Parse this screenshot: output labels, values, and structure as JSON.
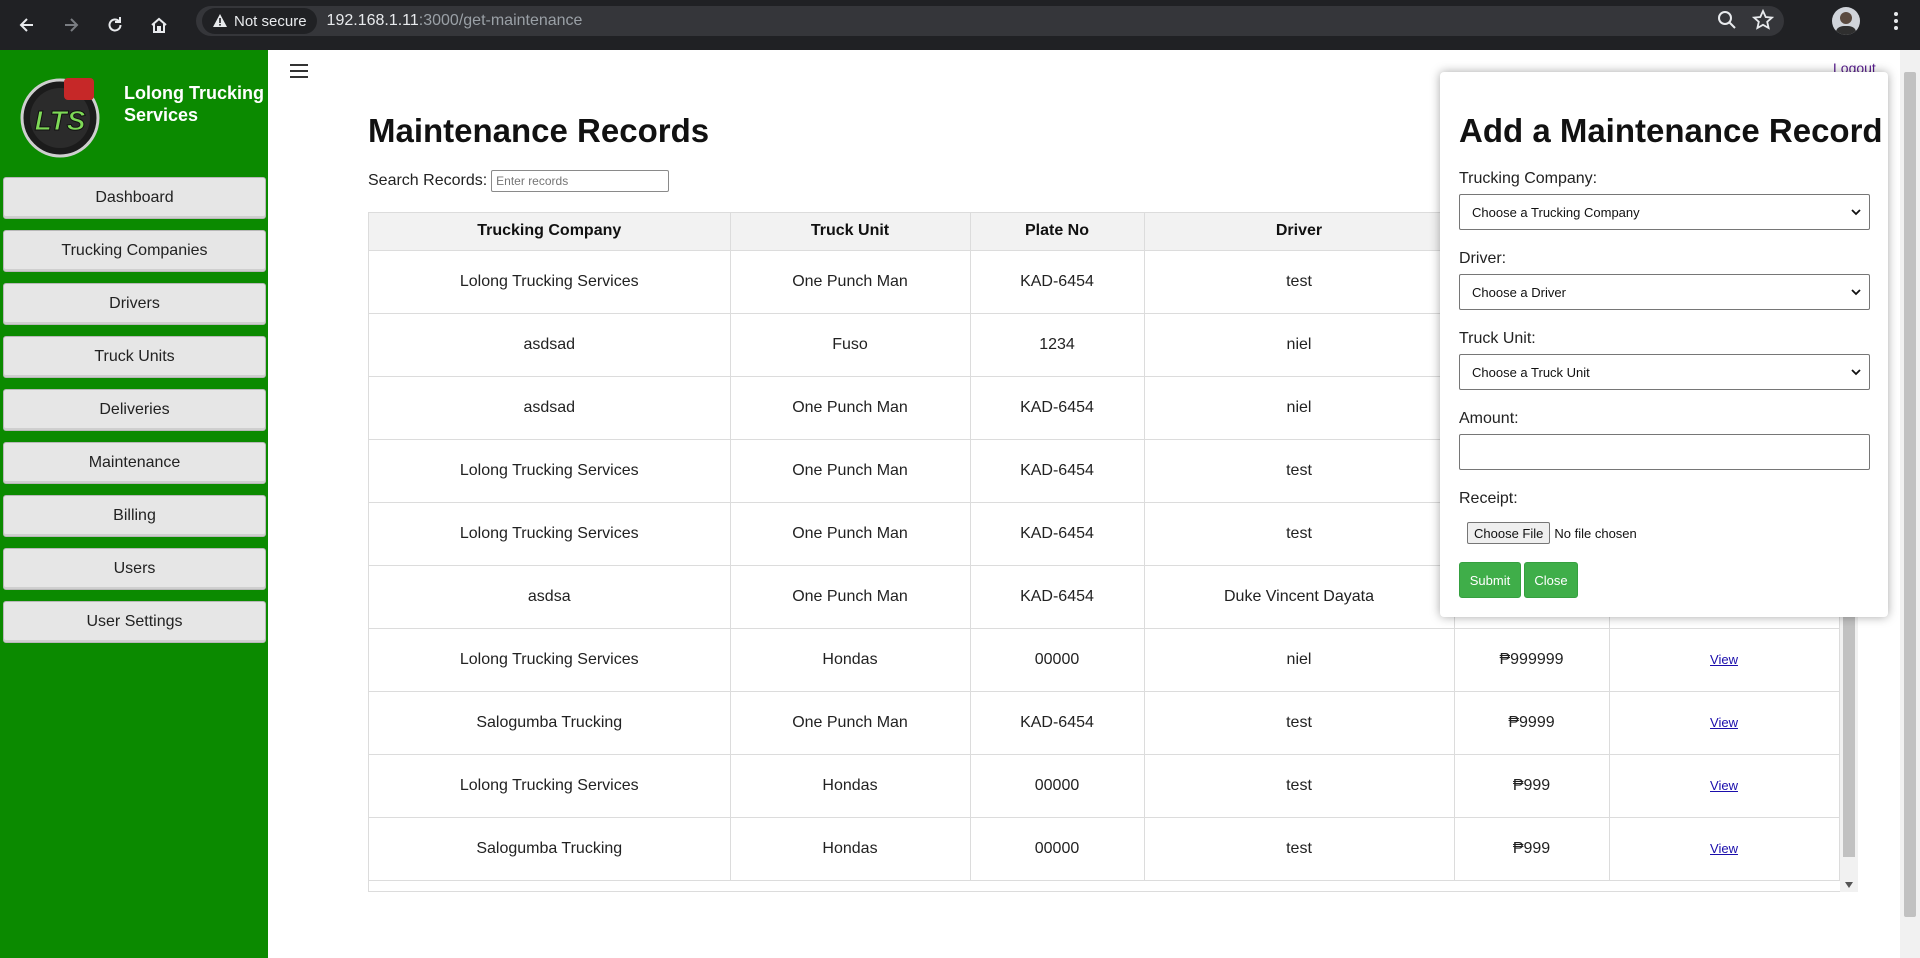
{
  "browser": {
    "security_label": "Not secure",
    "url_host": "192.168.1.11",
    "url_rest": ":3000/get-maintenance"
  },
  "sidebar": {
    "brand_name": "Lolong Trucking Services",
    "logo_text": "LTS",
    "items": [
      {
        "label": "Dashboard"
      },
      {
        "label": "Trucking Companies"
      },
      {
        "label": "Drivers"
      },
      {
        "label": "Truck Units"
      },
      {
        "label": "Deliveries"
      },
      {
        "label": "Maintenance"
      },
      {
        "label": "Billing"
      },
      {
        "label": "Users"
      },
      {
        "label": "User Settings"
      }
    ],
    "accent_color": "#0b8a00"
  },
  "header": {
    "logout_label": "Logout"
  },
  "main": {
    "title": "Maintenance Records",
    "search_label": "Search Records:",
    "search_placeholder": "Enter records",
    "table": {
      "columns": [
        "Trucking Company",
        "Truck Unit",
        "Plate No",
        "Driver",
        "",
        ""
      ],
      "rows": [
        [
          "Lolong Trucking Services",
          "One Punch Man",
          "KAD-6454",
          "test",
          "",
          ""
        ],
        [
          "asdsad",
          "Fuso",
          "1234",
          "niel",
          "",
          ""
        ],
        [
          "asdsad",
          "One Punch Man",
          "KAD-6454",
          "niel",
          "",
          ""
        ],
        [
          "Lolong Trucking Services",
          "One Punch Man",
          "KAD-6454",
          "test",
          "",
          ""
        ],
        [
          "Lolong Trucking Services",
          "One Punch Man",
          "KAD-6454",
          "test",
          "",
          ""
        ],
        [
          "asdsa",
          "One Punch Man",
          "KAD-6454",
          "Duke Vincent Dayata",
          "",
          ""
        ],
        [
          "Lolong Trucking Services",
          "Hondas",
          "00000",
          "niel",
          "₱999999",
          "View"
        ],
        [
          "Salogumba Trucking",
          "One Punch Man",
          "KAD-6454",
          "test",
          "₱9999",
          "View"
        ],
        [
          "Lolong Trucking Services",
          "Hondas",
          "00000",
          "test",
          "₱999",
          "View"
        ],
        [
          "Salogumba Trucking",
          "Hondas",
          "00000",
          "test",
          "₱999",
          "View"
        ]
      ]
    }
  },
  "modal": {
    "title": "Add a Maintenance Record",
    "company_label": "Trucking Company:",
    "company_value": "Choose a Trucking Company",
    "driver_label": "Driver:",
    "driver_value": "Choose a Driver",
    "truck_label": "Truck Unit:",
    "truck_value": "Choose a Truck Unit",
    "amount_label": "Amount:",
    "amount_value": "",
    "receipt_label": "Receipt:",
    "choose_file_label": "Choose File",
    "file_status": "No file chosen",
    "submit_label": "Submit",
    "close_label": "Close",
    "button_color": "#3fae49"
  }
}
